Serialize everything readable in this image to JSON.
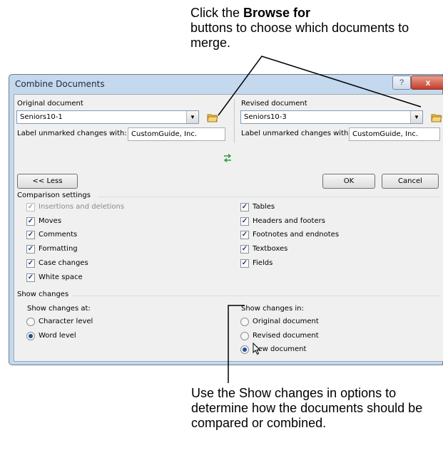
{
  "callout_top": {
    "prefix": "Click the ",
    "bold": "Browse for",
    "rest": "buttons to choose which documents to merge."
  },
  "callout_bottom": "Use the Show changes in options to determine how the documents should be compared or combined.",
  "dialog": {
    "title": "Combine Documents",
    "help_label": "?",
    "close_label": "x",
    "original": {
      "heading": "Original document",
      "value": "Seniors10-1",
      "label_text": "Label unmarked changes with:",
      "label_value": "CustomGuide, Inc."
    },
    "revised": {
      "heading": "Revised document",
      "value": "Seniors10-3",
      "label_text": "Label unmarked changes with:",
      "label_value": "CustomGuide, Inc."
    },
    "swap_icon": "swap-arrows-icon",
    "less_button": "<< Less",
    "ok_button": "OK",
    "cancel_button": "Cancel",
    "comparison_heading": "Comparison settings",
    "left_checks": [
      {
        "label": "Insertions and deletions",
        "checked": true,
        "disabled": true
      },
      {
        "label": "Moves",
        "checked": true,
        "disabled": false
      },
      {
        "label": "Comments",
        "checked": true,
        "disabled": false
      },
      {
        "label": "Formatting",
        "checked": true,
        "disabled": false
      },
      {
        "label": "Case changes",
        "checked": true,
        "disabled": false
      },
      {
        "label": "White space",
        "checked": true,
        "disabled": false
      }
    ],
    "right_checks": [
      {
        "label": "Tables",
        "checked": true,
        "disabled": false
      },
      {
        "label": "Headers and footers",
        "checked": true,
        "disabled": false
      },
      {
        "label": "Footnotes and endnotes",
        "checked": true,
        "disabled": false
      },
      {
        "label": "Textboxes",
        "checked": true,
        "disabled": false
      },
      {
        "label": "Fields",
        "checked": true,
        "disabled": false
      }
    ],
    "show_changes_heading": "Show changes",
    "show_at_heading": "Show changes at:",
    "show_at_options": [
      {
        "label": "Character level",
        "selected": false
      },
      {
        "label": "Word level",
        "selected": true
      }
    ],
    "show_in_heading": "Show changes in:",
    "show_in_options": [
      {
        "label": "Original document",
        "selected": false
      },
      {
        "label": "Revised document",
        "selected": false
      },
      {
        "label": "New document",
        "selected": true
      }
    ]
  }
}
